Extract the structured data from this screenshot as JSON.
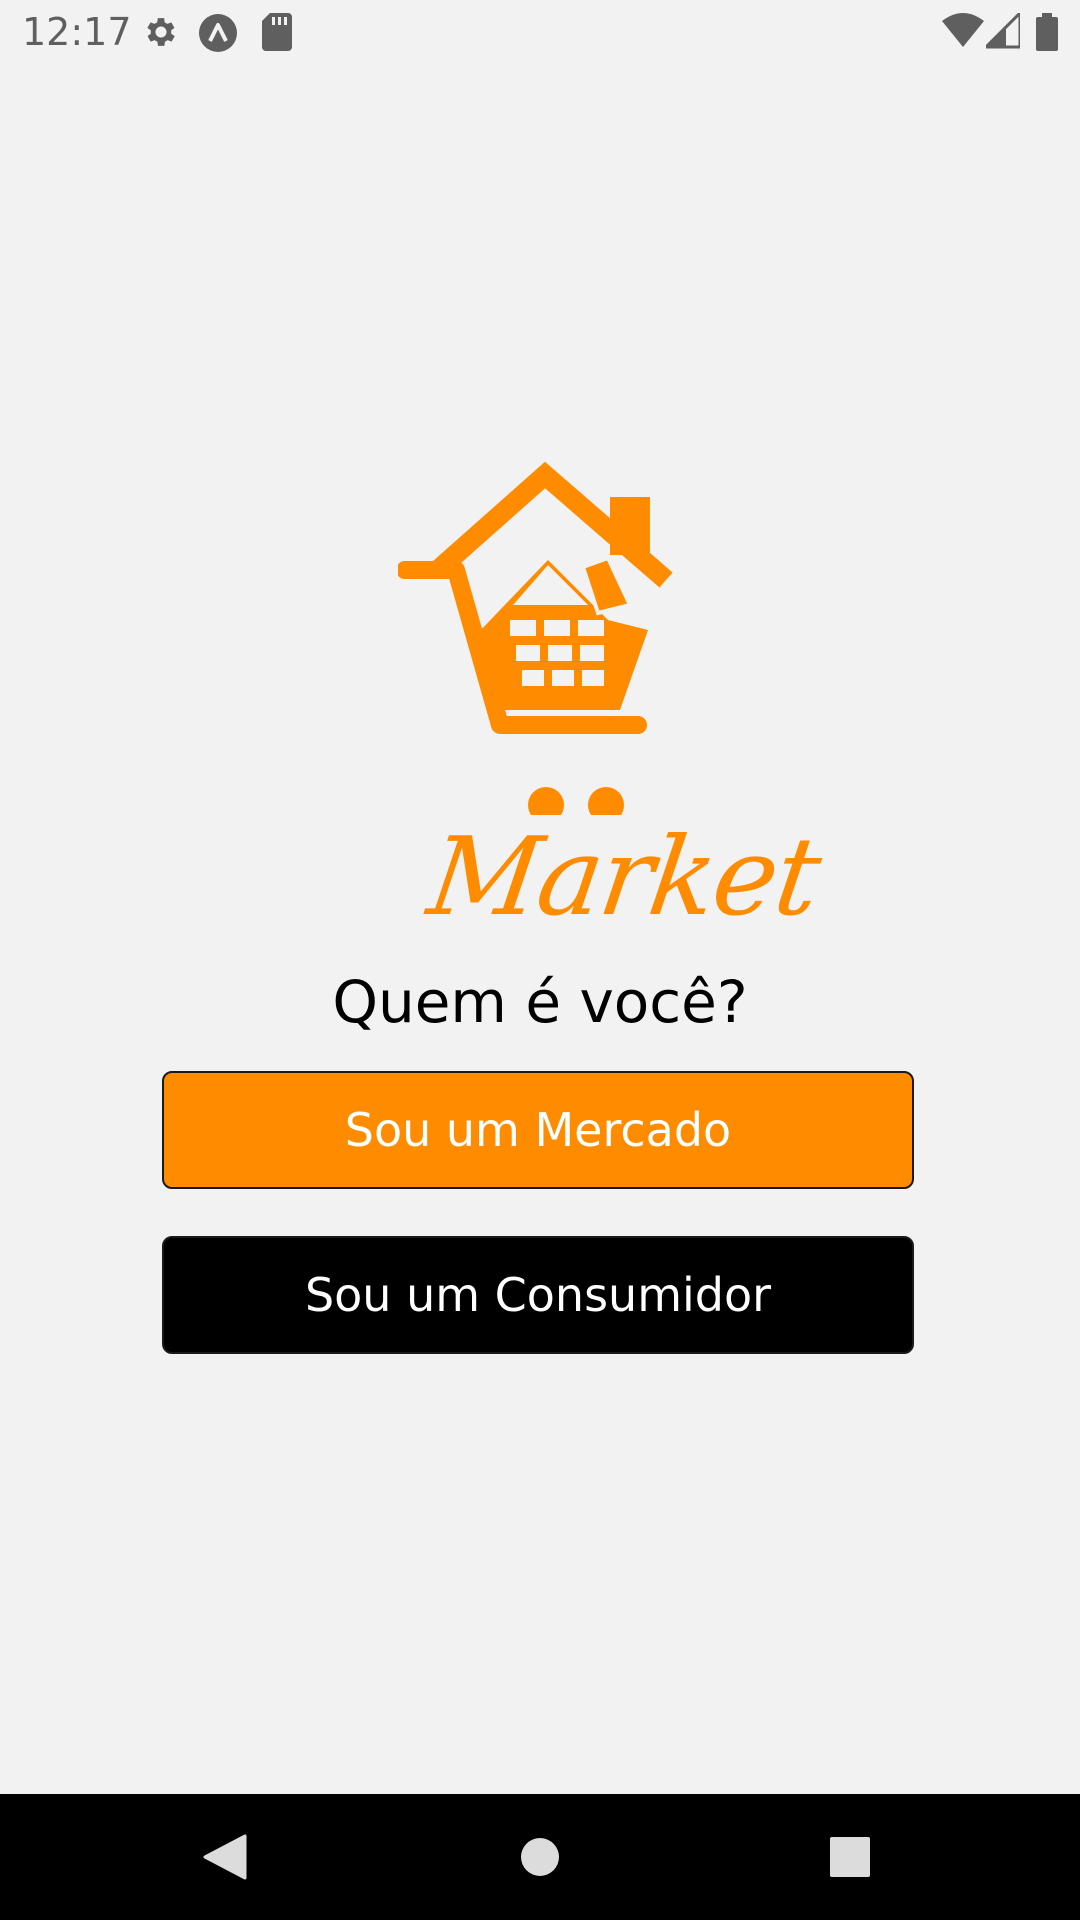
{
  "status_bar": {
    "time": "12:17",
    "left_icons": [
      "gear-icon",
      "app-launcher-icon",
      "sd-card-icon"
    ],
    "right_icons": [
      "wifi-icon",
      "cell-signal-icon",
      "battery-icon"
    ]
  },
  "logo": {
    "text": "Market",
    "color": "#ff8c00"
  },
  "question": "Quem é você?",
  "buttons": {
    "market_label": "Sou um Mercado",
    "consumer_label": "Sou um Consumidor",
    "market_color": "#ff8c00",
    "consumer_color": "#000000"
  },
  "nav_bar": {
    "icons": [
      "back-icon",
      "home-icon",
      "recents-icon"
    ]
  }
}
